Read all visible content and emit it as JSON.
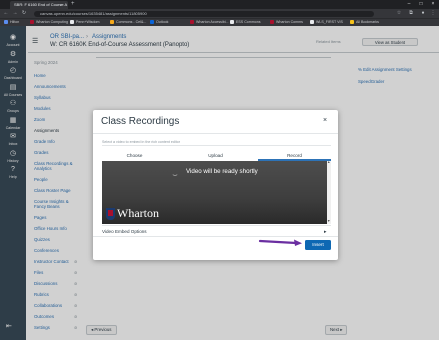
{
  "browser": {
    "tab_title": "SBR: F 6160 End of Course A",
    "tab_close": "×",
    "new_tab": "+",
    "window_controls": [
      "–",
      "□",
      "×"
    ],
    "url": "canvas.upenn.edu/courses/1635481/assignments/11805900",
    "bookmarks": [
      {
        "label": "Hilton",
        "color": "#5b8def"
      },
      {
        "label": "Wharton Computing",
        "color": "#a8102d"
      },
      {
        "label": "Penn+Wisdom",
        "color": "#e8eaed"
      },
      {
        "label": "Commons - Cel&...",
        "color": "#f6a91b"
      },
      {
        "label": "Outlook",
        "color": "#0a64d8"
      },
      {
        "label": "Wharton Accessibi...",
        "color": "#a8102d"
      },
      {
        "label": "ESS Commons",
        "color": "#e8eaed"
      },
      {
        "label": "Wharton Comms",
        "color": "#a8102d"
      },
      {
        "label": "WLS_FIRST VIS",
        "color": "#e8eaed"
      },
      {
        "label": "All Bookmarks",
        "color": "#f6c21b"
      }
    ]
  },
  "global_nav": [
    {
      "label": "Account",
      "icon": "account-icon"
    },
    {
      "label": "Admin",
      "icon": "admin-icon"
    },
    {
      "label": "Dashboard",
      "icon": "dashboard-icon"
    },
    {
      "label": "All Courses",
      "icon": "courses-icon"
    },
    {
      "label": "Groups",
      "icon": "groups-icon"
    },
    {
      "label": "Calendar",
      "icon": "calendar-icon"
    },
    {
      "label": "Inbox",
      "icon": "inbox-icon"
    },
    {
      "label": "History",
      "icon": "history-icon"
    },
    {
      "label": "Help",
      "icon": "help-icon"
    }
  ],
  "header": {
    "crumb1": "OR SBI-pa...",
    "crumb2": "Assignments",
    "crumb3": "W: CR 6160K End-of-Course Assessment (Panopto)",
    "related_items": "Related Items",
    "student_view": "View as Student"
  },
  "course_nav": {
    "term_label": "Spring 2024",
    "items": [
      "Home",
      "Announcements",
      "Syllabus",
      "Modules",
      "Zoom",
      "Assignments",
      "Grade Info",
      "Grades",
      "Class Recordings & Analytics",
      "People",
      "Class Roster Page",
      "Course Insights & Fancy Beans",
      "Pages",
      "Office Hours Info",
      "Quizzes",
      "Conferences",
      "Instructor Contact",
      "Files",
      "Discussions",
      "Rubrics",
      "Collaborations",
      "Outcomes",
      "Settings"
    ]
  },
  "sidebar": {
    "links": [
      "% Edit Assignment Settings",
      "SpeedGrader"
    ]
  },
  "footer": {
    "prev": "◂ Previous",
    "next": "Next ▸"
  },
  "modal": {
    "title": "Class Recordings",
    "close": "×",
    "fieldset_text": "Select a video to embed in the rich content editor",
    "tabs": [
      "Choose",
      "Upload",
      "Record"
    ],
    "active_tab": "Record",
    "video_message": "Video will be ready shortly",
    "spinner": "‿",
    "logo_text": "Wharton",
    "embed_options": "Video Embed Options",
    "embed_chevron": "▸",
    "insert_button": "Insert",
    "accent_color": "#0e68b3",
    "annotation_arrow_color": "#6b2fa1"
  }
}
